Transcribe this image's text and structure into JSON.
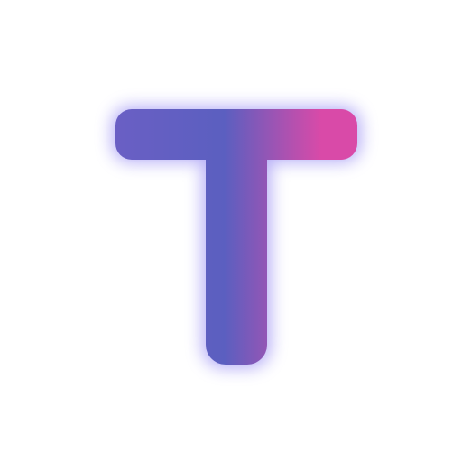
{
  "logo": {
    "letter": "T",
    "icon": "letter-t-logo-icon",
    "colors": {
      "gradient_start": "#6a5fc4",
      "gradient_mid": "#5b5fc0",
      "gradient_end": "#d94aa8",
      "glow": "#7a6cf0",
      "background": "#ffffff"
    }
  }
}
